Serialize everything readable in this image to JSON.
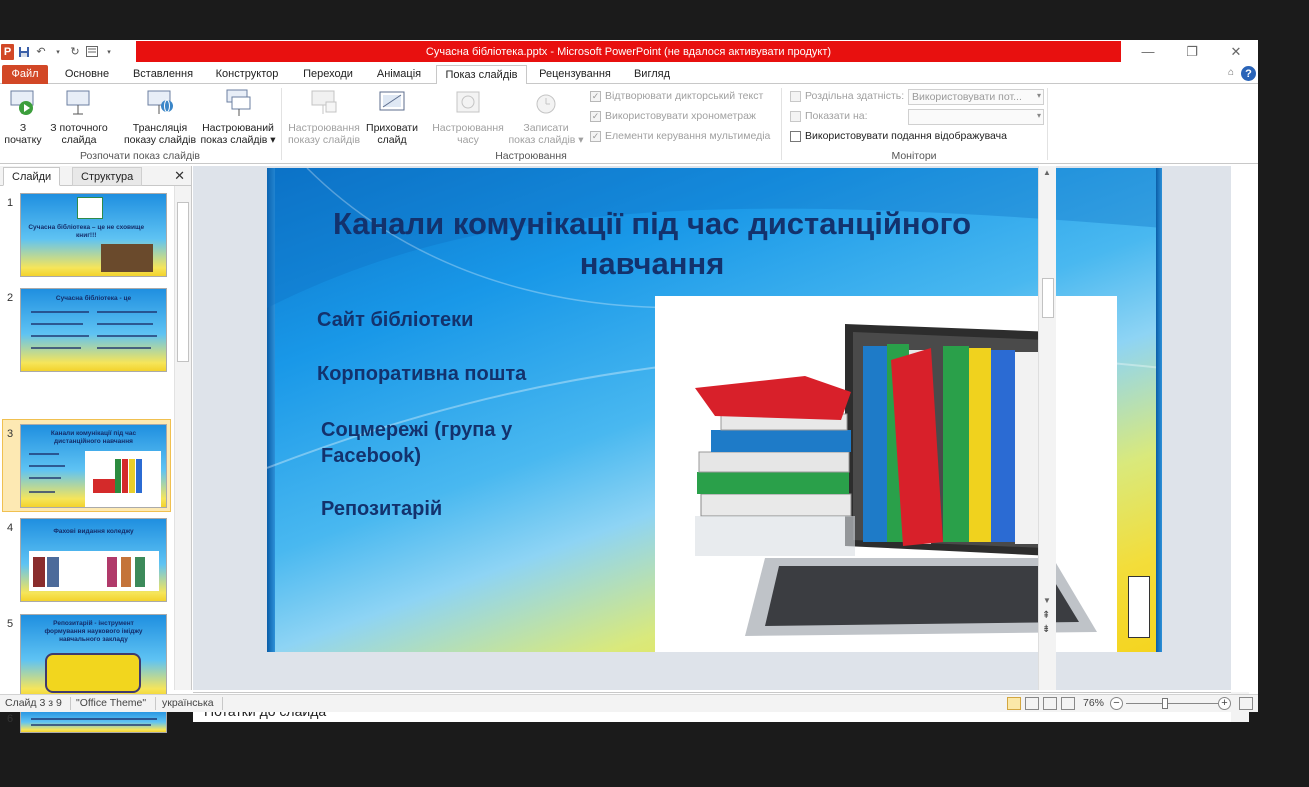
{
  "window": {
    "title": "Сучасна бібліотека.pptx - Microsoft PowerPoint (не вдалося активувати продукт)",
    "app_icon_letter": "P",
    "minimize": "—",
    "maximize": "❐",
    "close": "✕"
  },
  "tabs": [
    {
      "label": "Файл"
    },
    {
      "label": "Основне"
    },
    {
      "label": "Вставлення"
    },
    {
      "label": "Конструктор"
    },
    {
      "label": "Переходи"
    },
    {
      "label": "Анімація"
    },
    {
      "label": "Показ слайдів"
    },
    {
      "label": "Рецензування"
    },
    {
      "label": "Вигляд"
    }
  ],
  "ribbon": {
    "start_group_label": "Розпочати показ слайдів",
    "from_start": "З\nпочатку",
    "from_current": "З поточного\nслайда",
    "broadcast": "Трансляція\nпоказу слайдів",
    "custom_show": "Настроюваний\nпоказ слайдів ▾",
    "setup_group_label": "Настроювання",
    "setup_show": "Настроювання\nпоказу слайдів",
    "hide_slide": "Приховати\nслайд",
    "rehearse": "Настроювання\nчасу",
    "record": "Записати\nпоказ слайдів ▾",
    "play_narrations": "Відтворювати дикторський текст",
    "use_timings": "Використовувати хронометраж",
    "show_media_controls": "Елементи керування мультимедіа",
    "monitors_group_label": "Монітори",
    "resolution_label": "Роздільна здатність:",
    "resolution_value": "Використовувати пот...",
    "show_on_label": "Показати на:",
    "show_on_value": "",
    "presenter_view": "Використовувати подання відображувача"
  },
  "panel": {
    "tab_slides": "Слайди",
    "tab_outline": "Структура",
    "close": "✕",
    "thumbs": [
      {
        "num": "1",
        "title": "Сучасна бібліотека – це не сховище книг!!!"
      },
      {
        "num": "2",
        "title": "Сучасна бібліотека - це"
      },
      {
        "num": "3",
        "title": "Канали комунікації під час дистанційного навчання"
      },
      {
        "num": "4",
        "title": "Фахові видання коледжу"
      },
      {
        "num": "5",
        "title": "Репозитарій - інструмент формування наукового іміджу навчального закладу"
      },
      {
        "num": "6",
        "title": ""
      }
    ]
  },
  "slide": {
    "title": "Канали комунікації під час дистанційного навчання",
    "items": [
      "Сайт бібліотеки",
      "Корпоративна пошта",
      "Соцмережі (група у Facebook)",
      "Репозитарій"
    ]
  },
  "notes": {
    "placeholder": "Нотатки до слайда"
  },
  "status": {
    "slide_counter": "Слайд 3 з 9",
    "theme": "\"Office Theme\"",
    "language": "українська",
    "zoom": "76%",
    "zoom_level": 0.42
  },
  "colors": {
    "title_bar_red": "#e8100f",
    "file_tab": "#d24726",
    "slide_text": "#13326d",
    "selection": "#f3c649"
  }
}
